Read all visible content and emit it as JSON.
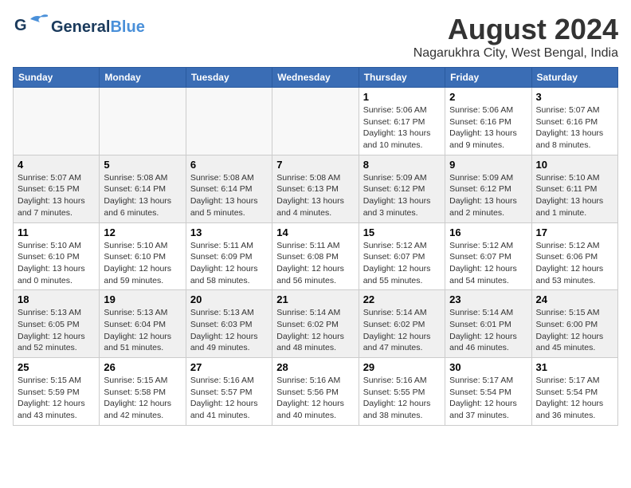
{
  "header": {
    "logo_general": "General",
    "logo_blue": "Blue",
    "month_year": "August 2024",
    "location": "Nagarukhra City, West Bengal, India"
  },
  "days_of_week": [
    "Sunday",
    "Monday",
    "Tuesday",
    "Wednesday",
    "Thursday",
    "Friday",
    "Saturday"
  ],
  "weeks": [
    [
      {
        "day": "",
        "empty": true
      },
      {
        "day": "",
        "empty": true
      },
      {
        "day": "",
        "empty": true
      },
      {
        "day": "",
        "empty": true
      },
      {
        "day": "1",
        "sunrise": "5:06 AM",
        "sunset": "6:17 PM",
        "daylight": "13 hours and 10 minutes."
      },
      {
        "day": "2",
        "sunrise": "5:06 AM",
        "sunset": "6:16 PM",
        "daylight": "13 hours and 9 minutes."
      },
      {
        "day": "3",
        "sunrise": "5:07 AM",
        "sunset": "6:16 PM",
        "daylight": "13 hours and 8 minutes."
      }
    ],
    [
      {
        "day": "4",
        "sunrise": "5:07 AM",
        "sunset": "6:15 PM",
        "daylight": "13 hours and 7 minutes."
      },
      {
        "day": "5",
        "sunrise": "5:08 AM",
        "sunset": "6:14 PM",
        "daylight": "13 hours and 6 minutes."
      },
      {
        "day": "6",
        "sunrise": "5:08 AM",
        "sunset": "6:14 PM",
        "daylight": "13 hours and 5 minutes."
      },
      {
        "day": "7",
        "sunrise": "5:08 AM",
        "sunset": "6:13 PM",
        "daylight": "13 hours and 4 minutes."
      },
      {
        "day": "8",
        "sunrise": "5:09 AM",
        "sunset": "6:12 PM",
        "daylight": "13 hours and 3 minutes."
      },
      {
        "day": "9",
        "sunrise": "5:09 AM",
        "sunset": "6:12 PM",
        "daylight": "13 hours and 2 minutes."
      },
      {
        "day": "10",
        "sunrise": "5:10 AM",
        "sunset": "6:11 PM",
        "daylight": "13 hours and 1 minute."
      }
    ],
    [
      {
        "day": "11",
        "sunrise": "5:10 AM",
        "sunset": "6:10 PM",
        "daylight": "13 hours and 0 minutes."
      },
      {
        "day": "12",
        "sunrise": "5:10 AM",
        "sunset": "6:10 PM",
        "daylight": "12 hours and 59 minutes."
      },
      {
        "day": "13",
        "sunrise": "5:11 AM",
        "sunset": "6:09 PM",
        "daylight": "12 hours and 58 minutes."
      },
      {
        "day": "14",
        "sunrise": "5:11 AM",
        "sunset": "6:08 PM",
        "daylight": "12 hours and 56 minutes."
      },
      {
        "day": "15",
        "sunrise": "5:12 AM",
        "sunset": "6:07 PM",
        "daylight": "12 hours and 55 minutes."
      },
      {
        "day": "16",
        "sunrise": "5:12 AM",
        "sunset": "6:07 PM",
        "daylight": "12 hours and 54 minutes."
      },
      {
        "day": "17",
        "sunrise": "5:12 AM",
        "sunset": "6:06 PM",
        "daylight": "12 hours and 53 minutes."
      }
    ],
    [
      {
        "day": "18",
        "sunrise": "5:13 AM",
        "sunset": "6:05 PM",
        "daylight": "12 hours and 52 minutes."
      },
      {
        "day": "19",
        "sunrise": "5:13 AM",
        "sunset": "6:04 PM",
        "daylight": "12 hours and 51 minutes."
      },
      {
        "day": "20",
        "sunrise": "5:13 AM",
        "sunset": "6:03 PM",
        "daylight": "12 hours and 49 minutes."
      },
      {
        "day": "21",
        "sunrise": "5:14 AM",
        "sunset": "6:02 PM",
        "daylight": "12 hours and 48 minutes."
      },
      {
        "day": "22",
        "sunrise": "5:14 AM",
        "sunset": "6:02 PM",
        "daylight": "12 hours and 47 minutes."
      },
      {
        "day": "23",
        "sunrise": "5:14 AM",
        "sunset": "6:01 PM",
        "daylight": "12 hours and 46 minutes."
      },
      {
        "day": "24",
        "sunrise": "5:15 AM",
        "sunset": "6:00 PM",
        "daylight": "12 hours and 45 minutes."
      }
    ],
    [
      {
        "day": "25",
        "sunrise": "5:15 AM",
        "sunset": "5:59 PM",
        "daylight": "12 hours and 43 minutes."
      },
      {
        "day": "26",
        "sunrise": "5:15 AM",
        "sunset": "5:58 PM",
        "daylight": "12 hours and 42 minutes."
      },
      {
        "day": "27",
        "sunrise": "5:16 AM",
        "sunset": "5:57 PM",
        "daylight": "12 hours and 41 minutes."
      },
      {
        "day": "28",
        "sunrise": "5:16 AM",
        "sunset": "5:56 PM",
        "daylight": "12 hours and 40 minutes."
      },
      {
        "day": "29",
        "sunrise": "5:16 AM",
        "sunset": "5:55 PM",
        "daylight": "12 hours and 38 minutes."
      },
      {
        "day": "30",
        "sunrise": "5:17 AM",
        "sunset": "5:54 PM",
        "daylight": "12 hours and 37 minutes."
      },
      {
        "day": "31",
        "sunrise": "5:17 AM",
        "sunset": "5:54 PM",
        "daylight": "12 hours and 36 minutes."
      }
    ]
  ]
}
